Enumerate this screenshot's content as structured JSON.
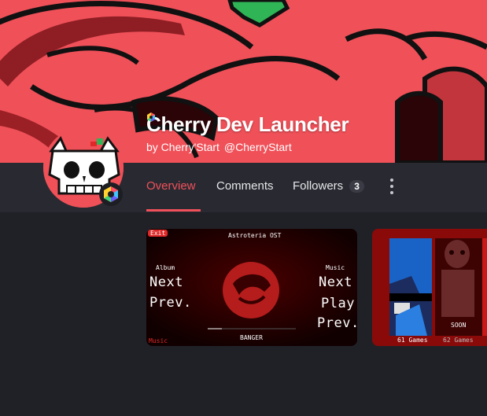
{
  "app": {
    "title": "Cherry Dev Launcher",
    "by_prefix": "by Cherry'Start",
    "handle": "@CherryStart"
  },
  "nav": {
    "tabs": [
      {
        "label": "Overview",
        "active": true
      },
      {
        "label": "Comments",
        "active": false
      },
      {
        "label": "Followers",
        "active": false,
        "count": "3"
      }
    ],
    "more_icon": "more-vertical-icon"
  },
  "colors": {
    "accent": "#f0505a",
    "banner": "#f05058",
    "background": "#202127",
    "nav_bar": "#292a31"
  },
  "cards": [
    {
      "tag": "Exit",
      "heading": "Astroteria OST",
      "left_label": "Album",
      "left_items": [
        "Next",
        "Prev."
      ],
      "right_label": "Music",
      "right_items": [
        "Next",
        "Play",
        "Prev."
      ],
      "track_name": "BANGER",
      "corner_label": "Music"
    },
    {
      "label_left": "61 Games",
      "label_right": "62 Games",
      "caption": "SOON"
    }
  ]
}
